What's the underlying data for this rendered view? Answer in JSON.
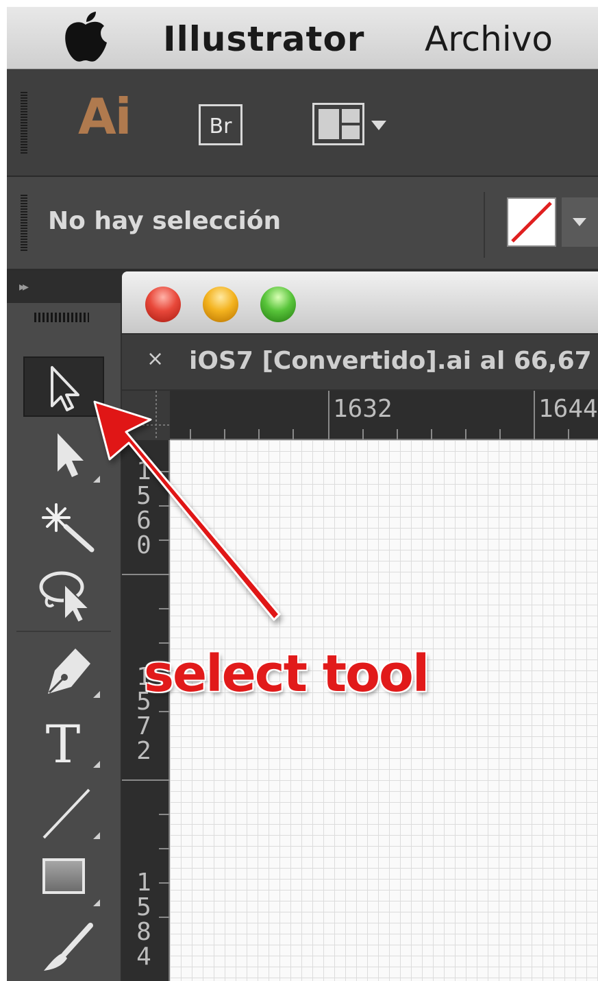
{
  "menubar": {
    "apple_icon": "apple-logo-icon",
    "app_name": "Illustrator",
    "file_menu": "Archivo"
  },
  "appbar": {
    "app_logo": "Ai",
    "bridge_button": "Br",
    "layout_icon": "workspace-layout-icon"
  },
  "controlbar": {
    "selection_status": "No hay selección",
    "stroke_swatch_color": "#e02020"
  },
  "toolpanel": {
    "collapse_glyph": "▸▸",
    "tools": [
      {
        "name": "selection-tool",
        "icon": "arrow-outline-icon",
        "selected": true
      },
      {
        "name": "direct-selection-tool",
        "icon": "arrow-filled-icon"
      },
      {
        "name": "magic-wand-tool",
        "icon": "magic-wand-icon"
      },
      {
        "name": "lasso-tool",
        "icon": "lasso-icon"
      },
      {
        "name": "pen-tool",
        "icon": "pen-nib-icon"
      },
      {
        "name": "type-tool",
        "icon": "type-icon",
        "glyph": "T"
      },
      {
        "name": "line-tool",
        "icon": "line-segment-icon"
      },
      {
        "name": "rectangle-tool",
        "icon": "rectangle-icon"
      },
      {
        "name": "paintbrush-tool",
        "icon": "paintbrush-icon"
      }
    ]
  },
  "document": {
    "close_glyph": "×",
    "tab_title": "iOS7 [Convertido].ai al 66,67",
    "ruler_h": [
      "1632",
      "1644"
    ],
    "ruler_v": [
      "1560",
      "1572",
      "1584"
    ]
  },
  "annotation": {
    "label": "select tool",
    "color": "#e11a1a"
  }
}
